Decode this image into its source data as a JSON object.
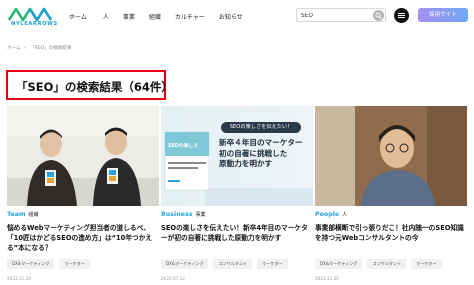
{
  "header": {
    "logo_text": "NYLEARROWS",
    "nav": [
      "ホーム",
      "人",
      "事業",
      "組織",
      "カルチャー",
      "お知らせ"
    ],
    "search_value": "SEO",
    "site_button": "採用サイト"
  },
  "breadcrumb": [
    "ホーム",
    "「SEO」の検索結果"
  ],
  "page_title": "「SEO」の検索結果（64件）",
  "articles": [
    {
      "category": "Team",
      "subcategory": "組織",
      "title": "悩めるWebマーケティング担当者の道しるべ、「10匠はかどるSEOの進め方」は“10年つかえる”本になる？",
      "tags": [
        "DX&マーケティング",
        "マーケター"
      ],
      "date": "2023.11.20"
    },
    {
      "category": "Business",
      "subcategory": "事業",
      "title": "SEOの楽しさを伝えたい！新卒4年目のマーケターが初の自著に挑戦した原動力を明かす",
      "tags": [
        "DX&マーケティング",
        "コンサルタント",
        "マーケター"
      ],
      "date": "2022.07.12",
      "banner": {
        "bubble": "SEOの楽しさを伝えたい！",
        "line1": "新卒４年目のマーケター",
        "line2": "初の自著に挑戦した",
        "line3": "原動力を明かす",
        "book": "SEOの楽しさ"
      }
    },
    {
      "category": "People",
      "subcategory": "人",
      "title": "事業部横断で引っ張りだこ！社内随一のSEO知識を持つ元Webコンサルタントの今",
      "tags": [
        "DX&マーケティング",
        "コンサルタント",
        "マーケター"
      ],
      "date": "2021.11.20"
    }
  ],
  "colors": {
    "accent": "#2aa3dc",
    "title_border": "#e60012",
    "site_button_from": "#a68ef0",
    "site_button_to": "#6fa8f2"
  }
}
